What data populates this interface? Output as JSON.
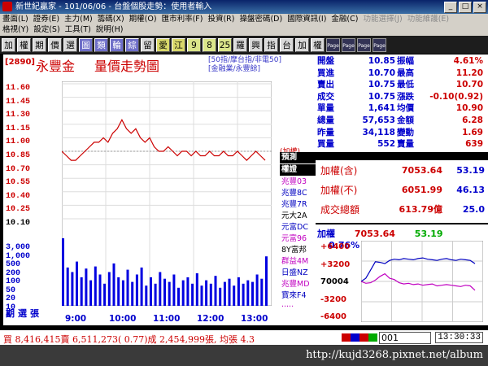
{
  "window": {
    "title": "新世紀贏家 - 101/06/06 - 台盤個股走勢：使用者輸入"
  },
  "menu": {
    "row1": [
      "畫面(L)",
      "證券(E)",
      "主力(M)",
      "籌碼(X)",
      "期權(O)",
      "匯市利率(F)",
      "投資(R)",
      "操盤密碼(D)",
      "國際資訊(I)",
      "金融(C)",
      "功能選擇(J)",
      "功能維護(E)"
    ],
    "row2": [
      "格視(Y)",
      "設定(S)",
      "工具(T)",
      "說明(H)"
    ]
  },
  "toolbar": {
    "buttons": [
      "加",
      "權",
      "期",
      "價",
      "選",
      "圖",
      "類",
      "輪",
      "綜",
      "留",
      "愛",
      "江",
      "9",
      "8",
      "25",
      "羅",
      "興",
      "指",
      "台",
      "加",
      "權"
    ],
    "icons": [
      "page-icon-1",
      "page-icon-2",
      "page-icon-3",
      "page-icon-4"
    ]
  },
  "chart": {
    "code": "[2890]",
    "name": "永豐金",
    "title": "量價走勢圖",
    "links": [
      "[50指/摩台指/非電50]",
      "[金融業/永豐餘]"
    ],
    "price_ticks": [
      "11.60",
      "11.45",
      "11.30",
      "11.15",
      "11.00",
      "10.85",
      "10.70",
      "10.55",
      "10.40",
      "10.25",
      "10.10"
    ],
    "volume_ticks": [
      "3,000",
      "1,000",
      "500",
      "200",
      "100",
      "50",
      "20",
      "10",
      "5"
    ],
    "volume_label": "期選張",
    "time_ticks": [
      "9:00",
      "10:00",
      "11:00",
      "12:00",
      "13:00"
    ],
    "tag_label": "(加權)",
    "brokers": [
      {
        "name": "預測",
        "style": "head"
      },
      {
        "name": "權證",
        "style": "head"
      },
      {
        "name": "兆豐03",
        "color": "#c000c0"
      },
      {
        "name": "兆豐8C",
        "color": "#0000c0"
      },
      {
        "name": "兆豐7R",
        "color": "#0000c0"
      },
      {
        "name": "元大2A",
        "color": "#000000"
      },
      {
        "name": "元富DC",
        "color": "#0000c0"
      },
      {
        "name": "元富96",
        "color": "#c000c0"
      },
      {
        "name": "8Y富邦",
        "color": "#000000"
      },
      {
        "name": "群益4M",
        "color": "#c000c0"
      },
      {
        "name": "日盛NZ",
        "color": "#0000c0"
      },
      {
        "name": "兆豐MD",
        "color": "#c000c0"
      },
      {
        "name": "寶來F4",
        "color": "#0000c0"
      },
      {
        "name": "·····",
        "color": "#c000c0"
      }
    ]
  },
  "chart_data": [
    {
      "type": "line",
      "x_range": [
        "9:00",
        "13:30"
      ],
      "ylim": [
        10.1,
        11.6
      ],
      "reference_price": 10.85,
      "series": [
        {
          "values": [
            10.85,
            10.8,
            10.75,
            10.75,
            10.8,
            10.85,
            10.9,
            10.95,
            10.95,
            11.0,
            10.95,
            11.05,
            11.1,
            11.2,
            11.1,
            11.05,
            11.1,
            11.0,
            10.95,
            11.0,
            10.9,
            10.85,
            10.85,
            10.9,
            10.85,
            10.8,
            10.85,
            10.85,
            10.8,
            10.85,
            10.8,
            10.8,
            10.85,
            10.8,
            10.8,
            10.85,
            10.8,
            10.8,
            10.85,
            10.8,
            10.75,
            10.8,
            10.85,
            10.8,
            10.75
          ]
        }
      ]
    },
    {
      "type": "bar",
      "x_range": [
        "9:00",
        "13:30"
      ],
      "values": [
        2800,
        900,
        700,
        1200,
        500,
        850,
        400,
        950,
        600,
        300,
        700,
        1100,
        500,
        400,
        800,
        350,
        600,
        900,
        250,
        500,
        300,
        700,
        450,
        350,
        600,
        200,
        400,
        500,
        300,
        650,
        250,
        400,
        300,
        550,
        200,
        350,
        450,
        250,
        500,
        300,
        400,
        350,
        600,
        450,
        1500
      ]
    },
    {
      "type": "line",
      "x_range": [
        "9:00",
        "13:30"
      ],
      "ylim": [
        -6400,
        6400
      ],
      "series": [
        {
          "values": [
            0,
            500,
            1800,
            3100,
            3000,
            2800,
            3300,
            3500,
            3400,
            3600,
            3500,
            3400,
            3600,
            3700,
            3500,
            3400,
            3300,
            3500,
            3600,
            3400,
            3300,
            3500,
            3400,
            3300,
            2800
          ]
        },
        {
          "values": [
            0,
            -300,
            -200,
            200,
            800,
            1200,
            500,
            300,
            -200,
            -400,
            -300,
            -500,
            -400,
            -600,
            -500,
            -400,
            -700,
            -600,
            -500,
            -600,
            -700,
            -800,
            -600,
            -700,
            -1400
          ]
        }
      ]
    }
  ],
  "quote": {
    "rows": [
      {
        "l1": "開盤",
        "v1": "10.85",
        "l2": "振幅",
        "v2": "4.61%"
      },
      {
        "l1": "買進",
        "v1": "10.70",
        "l2": "最高",
        "v2": "11.20"
      },
      {
        "l1": "賣出",
        "v1": "10.75",
        "l2": "最低",
        "v2": "10.70"
      },
      {
        "l1": "成交",
        "v1": "10.75",
        "l2": "漲跌",
        "v2": "-0.10(0.92)"
      },
      {
        "l1": "單量",
        "v1": "1,641",
        "l2": "均價",
        "v2": "10.90"
      },
      {
        "l1": "總量",
        "v1": "57,653",
        "l2": "金額",
        "v2": "6.28"
      },
      {
        "l1": "昨量",
        "v1": "34,118",
        "l2": "變動",
        "v2": "1.69"
      },
      {
        "l1": "買量",
        "v1": "552",
        "l2": "賣量",
        "v2": "639"
      }
    ]
  },
  "index": {
    "rows": [
      {
        "label": "加權(含)",
        "v1": "7053.64",
        "v2": "53.19"
      },
      {
        "label": "加權(不)",
        "v1": "6051.99",
        "v2": "46.13"
      },
      {
        "label": "成交總額",
        "v1": "613.79億",
        "v2": "25.0"
      }
    ]
  },
  "mini": {
    "label": "加權",
    "value": "7053.64",
    "change": "53.19",
    "pct": "0.76%",
    "ticks": [
      "+6400",
      "+3200",
      "70004",
      "-3200",
      "-6400"
    ]
  },
  "status": {
    "text": "買 8,416,415賣 6,511,273( 0.77)成 2,454,999張, 均張 4.3",
    "code": "001",
    "time": "13:30:33"
  },
  "watermark": {
    "url": "http://kujd3268.pixnet.net/album"
  },
  "colors": {
    "up": "#c00000",
    "down": "#0000c0",
    "bg": "#000000"
  }
}
